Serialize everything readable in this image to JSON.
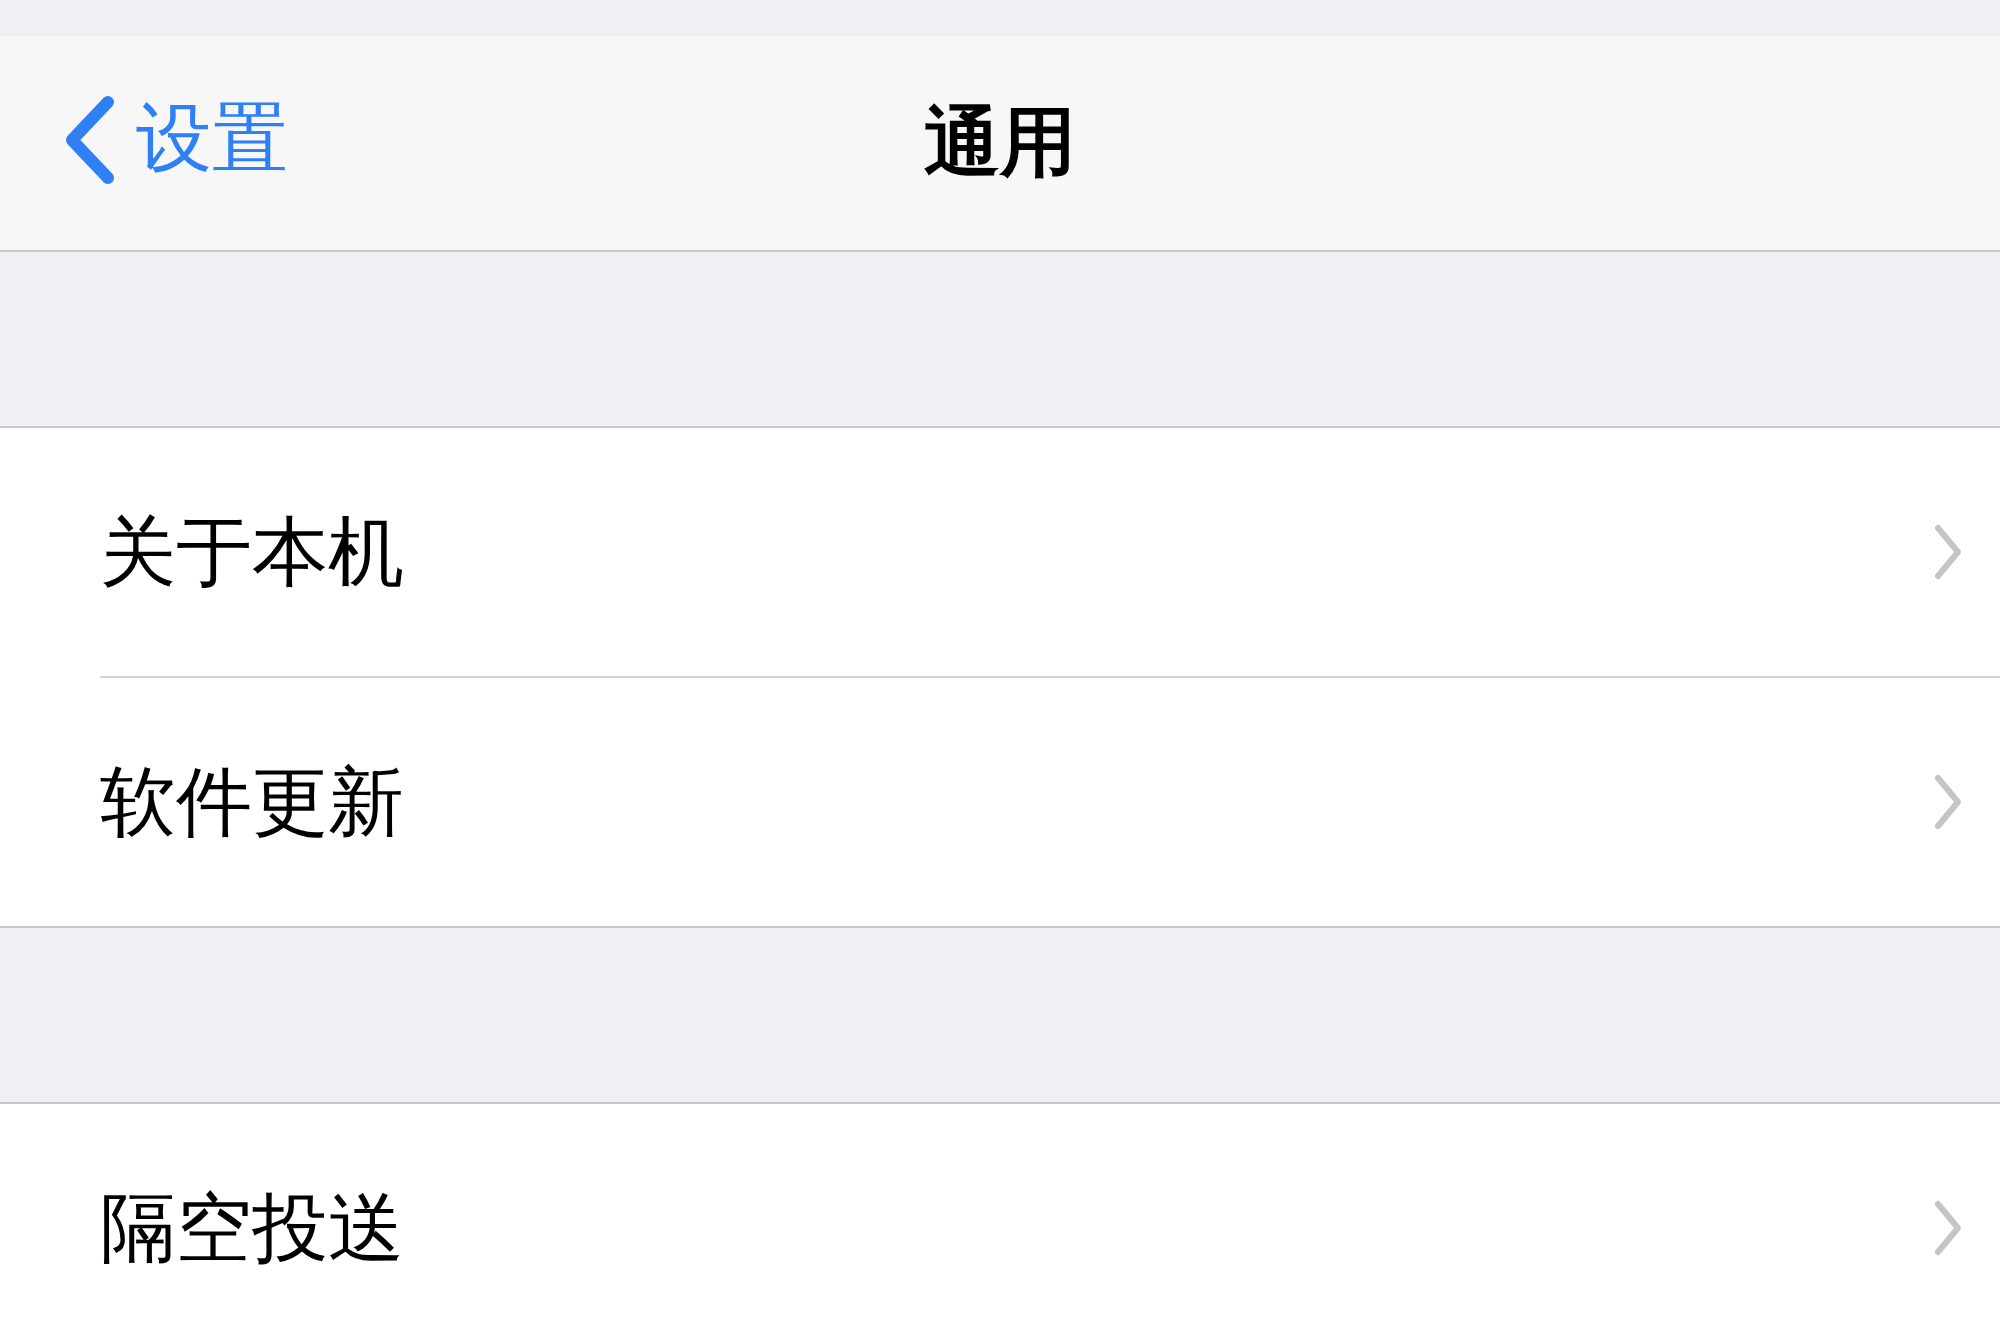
{
  "nav_bar": {
    "back_label": "设置",
    "title": "通用"
  },
  "sections": [
    {
      "rows": [
        {
          "label": "关于本机"
        },
        {
          "label": "软件更新"
        }
      ]
    },
    {
      "rows": [
        {
          "label": "隔空投送"
        }
      ]
    }
  ]
}
